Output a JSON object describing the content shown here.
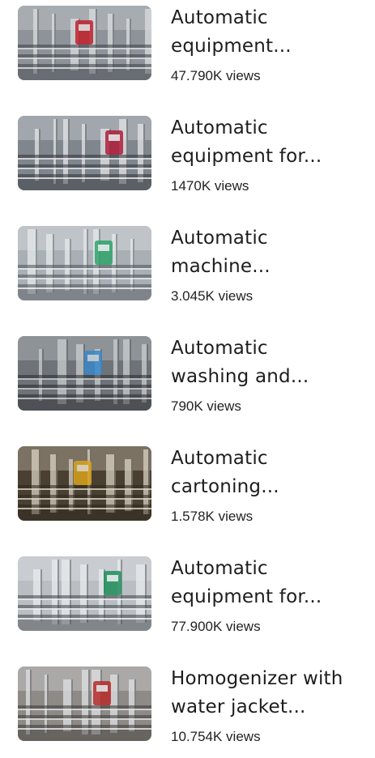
{
  "videos": [
    {
      "title_line1": "Automatic",
      "title_line2": "equipment...",
      "views": "47.790K views",
      "thumb_icon": "filling-line-thumbnail",
      "palette": {
        "bg": "#8d9399",
        "accent": "#c0202a",
        "metal": "#d9dde0",
        "dark": "#3b3f44"
      }
    },
    {
      "title_line1": "Automatic",
      "title_line2": "equipment for...",
      "views": "1470K views",
      "thumb_icon": "conveyor-thumbnail",
      "palette": {
        "bg": "#7f868d",
        "accent": "#b01d3a",
        "metal": "#e3e6e8",
        "dark": "#2f3338"
      }
    },
    {
      "title_line1": "Automatic",
      "title_line2": "machine...",
      "views": "3.045K views",
      "thumb_icon": "bottle-filler-thumbnail",
      "palette": {
        "bg": "#a9b0b5",
        "accent": "#2fa36b",
        "metal": "#e6eaec",
        "dark": "#4a5056"
      }
    },
    {
      "title_line1": "Automatic",
      "title_line2": "washing and...",
      "views": "790K views",
      "thumb_icon": "washing-machine-thumbnail",
      "palette": {
        "bg": "#6d7378",
        "accent": "#3a87c8",
        "metal": "#c9cdd0",
        "dark": "#25282b"
      }
    },
    {
      "title_line1": "Automatic",
      "title_line2": "cartoning...",
      "views": "1.578K views",
      "thumb_icon": "oil-filling-thumbnail",
      "palette": {
        "bg": "#4a4032",
        "accent": "#d9a21b",
        "metal": "#d8d2c2",
        "dark": "#2a241b"
      }
    },
    {
      "title_line1": "Automatic",
      "title_line2": "equipment for...",
      "views": "77.900K views",
      "thumb_icon": "control-panel-thumbnail",
      "palette": {
        "bg": "#b8bec2",
        "accent": "#1f8f5a",
        "metal": "#e8ebed",
        "dark": "#3d4246"
      }
    },
    {
      "title_line1": "Homogenizer with",
      "title_line2": "water jacket...",
      "views": "10.754K views",
      "thumb_icon": "homogenizer-thumbnail",
      "palette": {
        "bg": "#8e8a86",
        "accent": "#b72a2a",
        "metal": "#dfe2e4",
        "dark": "#3a3633"
      }
    }
  ]
}
